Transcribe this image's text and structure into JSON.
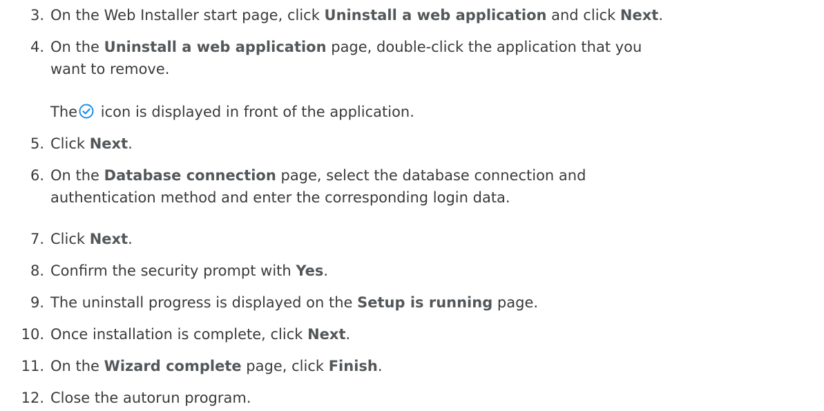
{
  "steps": [
    {
      "number": "3.",
      "parts": [
        {
          "t": "On the Web Installer start page, click "
        },
        {
          "t": "Uninstall a web application",
          "b": true
        },
        {
          "t": " and click "
        },
        {
          "t": "Next",
          "b": true
        },
        {
          "t": "."
        }
      ]
    },
    {
      "number": "4.",
      "lines": [
        [
          {
            "t": "On the "
          },
          {
            "t": "Uninstall a web application",
            "b": true
          },
          {
            "t": " page, double-click the application that you"
          }
        ],
        [
          {
            "t": "want to remove."
          }
        ]
      ]
    },
    {
      "number": "5.",
      "parts": [
        {
          "t": "Click "
        },
        {
          "t": "Next",
          "b": true
        },
        {
          "t": "."
        }
      ]
    },
    {
      "number": "6.",
      "lines": [
        [
          {
            "t": "On the "
          },
          {
            "t": "Database connection",
            "b": true
          },
          {
            "t": " page, select the database connection and"
          }
        ],
        [
          {
            "t": "authentication method and enter the corresponding login data."
          }
        ]
      ]
    },
    {
      "number": "7.",
      "parts": [
        {
          "t": "Click "
        },
        {
          "t": "Next",
          "b": true
        },
        {
          "t": "."
        }
      ]
    },
    {
      "number": "8.",
      "parts": [
        {
          "t": "Confirm the security prompt with "
        },
        {
          "t": "Yes",
          "b": true
        },
        {
          "t": "."
        }
      ]
    },
    {
      "number": "9.",
      "parts": [
        {
          "t": "The uninstall progress is displayed on the "
        },
        {
          "t": "Setup is running",
          "b": true
        },
        {
          "t": " page."
        }
      ]
    },
    {
      "number": "10.",
      "parts": [
        {
          "t": "Once installation is complete, click "
        },
        {
          "t": "Next",
          "b": true
        },
        {
          "t": "."
        }
      ]
    },
    {
      "number": "11.",
      "parts": [
        {
          "t": "On the "
        },
        {
          "t": "Wizard complete",
          "b": true
        },
        {
          "t": " page, click "
        },
        {
          "t": "Finish",
          "b": true
        },
        {
          "t": "."
        }
      ]
    },
    {
      "number": "12.",
      "parts": [
        {
          "t": "Close the autorun program."
        }
      ]
    }
  ],
  "note": {
    "before_icon": "The",
    "icon": "check-circle-icon",
    "after_icon": " icon is displayed in front of the application.",
    "icon_color": "#1e90e8"
  }
}
